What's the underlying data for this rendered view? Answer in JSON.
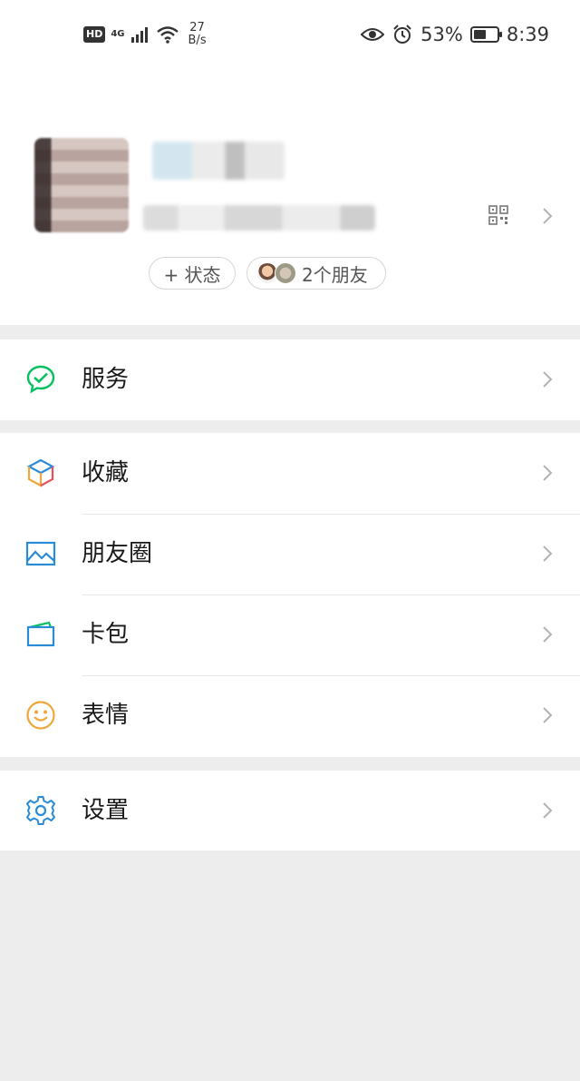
{
  "status_bar": {
    "hd": "HD",
    "network": "4G",
    "speed_value": "27",
    "speed_unit": "B/s",
    "battery_percent": "53%",
    "battery_level": 0.53,
    "time": "8:39"
  },
  "profile": {
    "status_button": "+ 状态",
    "friends_button": "2个朋友"
  },
  "menu": {
    "services": "服务",
    "favorites": "收藏",
    "moments": "朋友圈",
    "cards": "卡包",
    "stickers": "表情",
    "settings": "设置"
  },
  "colors": {
    "brand_green": "#07c160",
    "icon_blue": "#2a8bd6",
    "sticker_orange": "#f0a73a",
    "background": "#ededed"
  }
}
